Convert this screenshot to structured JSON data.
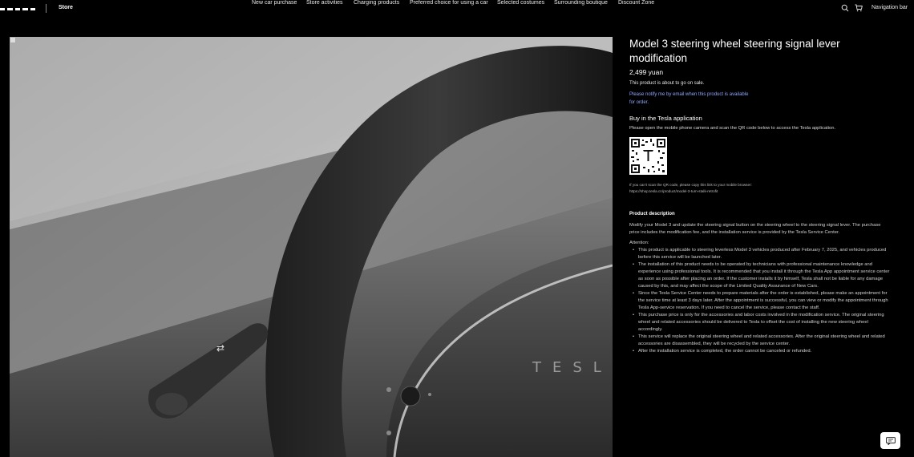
{
  "header": {
    "brand": "TESLA",
    "store_label": "Store",
    "nav_items": [
      "New car purchase",
      "Store activities",
      "Charging products",
      "Preferred choice for using a car",
      "Selected costumes",
      "Surrounding boutique",
      "Discount Zone"
    ],
    "navigation_bar_label": "Navigation bar",
    "icons": [
      "search-icon",
      "cart-icon"
    ]
  },
  "product": {
    "image_text": "TESLA",
    "title": "Model 3 steering wheel steering signal lever modification",
    "price": "2,499 yuan",
    "sale_note": "This product is about to go on sale.",
    "notify_link": "Please notify me by email when this product is available for order.",
    "buy_title": "Buy in the Tesla application",
    "buy_description": "Please open the mobile phone camera and scan the QR code below to access the Tesla application.",
    "qr_fallback_line1": "If you can't scan the QR code, please copy this link to your mobile browser:",
    "qr_fallback_link": "https://shop.tesla.cn/product/model-3-turn-stalk-retrofit",
    "description_heading": "Product description",
    "description_text": "Modify your Model 3 and update the steering signal button on the steering wheel to the steering signal lever. The purchase price includes the modification fee, and the installation service is provided by the Tesla Service Center.",
    "attention_label": "Attention:",
    "attention_items": [
      "This product is applicable to steering leverless Model 3 vehicles produced after February 7, 2025, and vehicles produced before this service will be launched later.",
      "The installation of this product needs to be operated by technicians with professional maintenance knowledge and experience using professional tools. It is recommended that you install it through the Tesla App appointment service center as soon as possible after placing an order. If the customer installs it by himself, Tesla shall not be liable for any damage caused by this, and may affect the scope of the Limited Quality Assurance of New Cars.",
      "Since the Tesla Service Center needs to prepare materials after the order is established, please make an appointment for the service time at least 3 days later. After the appointment is successful, you can view or modify the appointment through Tesla App-service reservation. If you need to cancel the service, please contact the staff.",
      "This purchase price is only for the accessories and labor costs involved in the modification service. The original steering wheel and related accessories should be delivered to Tesla to offset the cost of installing the new steering wheel accordingly.",
      "This service will replace the original steering wheel and related accessories. After the original steering wheel and related accessories are disassembled, they will be recycled by the service center.",
      "After the installation service is completed, the order cannot be canceled or refunded."
    ]
  },
  "colors": {
    "background": "#000000",
    "link": "#8fa6ff",
    "text": "#ffffff"
  },
  "chat": {
    "icon": "chat-icon"
  }
}
